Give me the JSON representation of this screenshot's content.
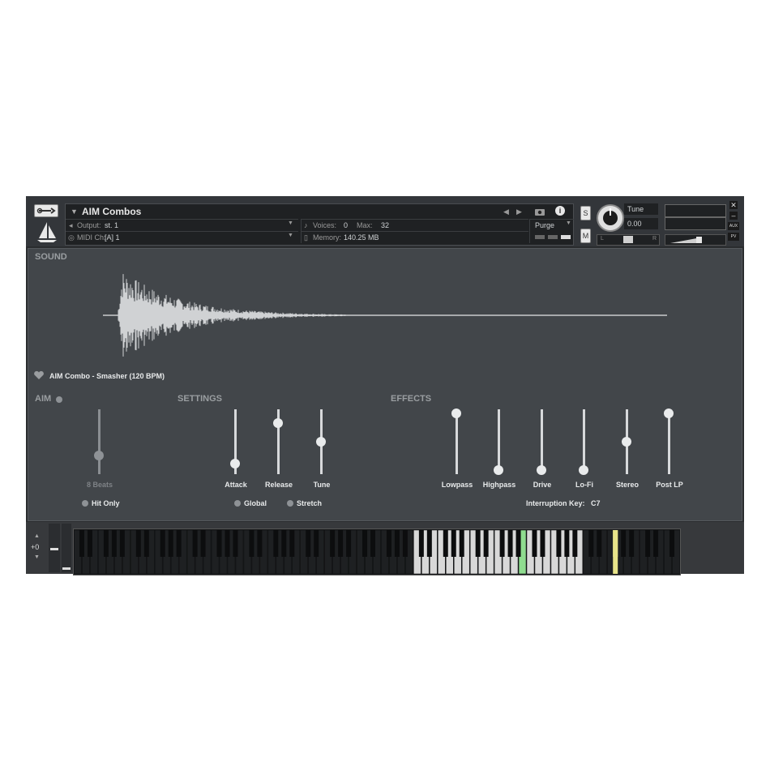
{
  "header": {
    "instrument_name": "AIM Combos",
    "output_label": "Output:",
    "output_value": "st. 1",
    "midi_label": "MIDI Ch:",
    "midi_value": "[A] 1",
    "voices_label": "Voices:",
    "voices_value": "0",
    "max_label": "Max:",
    "max_value": "32",
    "memory_label": "Memory:",
    "memory_value": "140.25 MB",
    "purge_label": "Purge",
    "solo_label": "S",
    "mute_label": "M",
    "tune_label": "Tune",
    "tune_value": "0.00",
    "pan_left": "L",
    "pan_right": "R",
    "aux_label": "AUX",
    "pv_label": "PV"
  },
  "sound": {
    "section_label": "SOUND",
    "sample_name": "AIM Combo - Smasher (120 BPM)"
  },
  "aim": {
    "section_label": "AIM",
    "slider_label": "8 Beats",
    "slider_level": 0.27,
    "hit_only_label": "Hit Only"
  },
  "settings": {
    "section_label": "SETTINGS",
    "sliders": [
      {
        "label": "Attack",
        "level": 0.12
      },
      {
        "label": "Release",
        "level": 0.82
      },
      {
        "label": "Tune",
        "level": 0.5
      }
    ],
    "global_label": "Global",
    "stretch_label": "Stretch"
  },
  "effects": {
    "section_label": "EFFECTS",
    "sliders": [
      {
        "label": "Lowpass",
        "level": 0.98
      },
      {
        "label": "Highpass",
        "level": 0.02
      },
      {
        "label": "Drive",
        "level": 0.02
      },
      {
        "label": "Lo-Fi",
        "level": 0.02
      },
      {
        "label": "Stereo",
        "level": 0.5
      },
      {
        "label": "Post LP",
        "level": 0.98
      }
    ],
    "interruption_label": "Interruption Key:",
    "interruption_value": "C7"
  },
  "keyboard": {
    "octave_value": "+0",
    "colors": {
      "active": "#d8d8d8",
      "pressed": "#8fdc8f",
      "key_switch": "#e8e48a"
    }
  }
}
